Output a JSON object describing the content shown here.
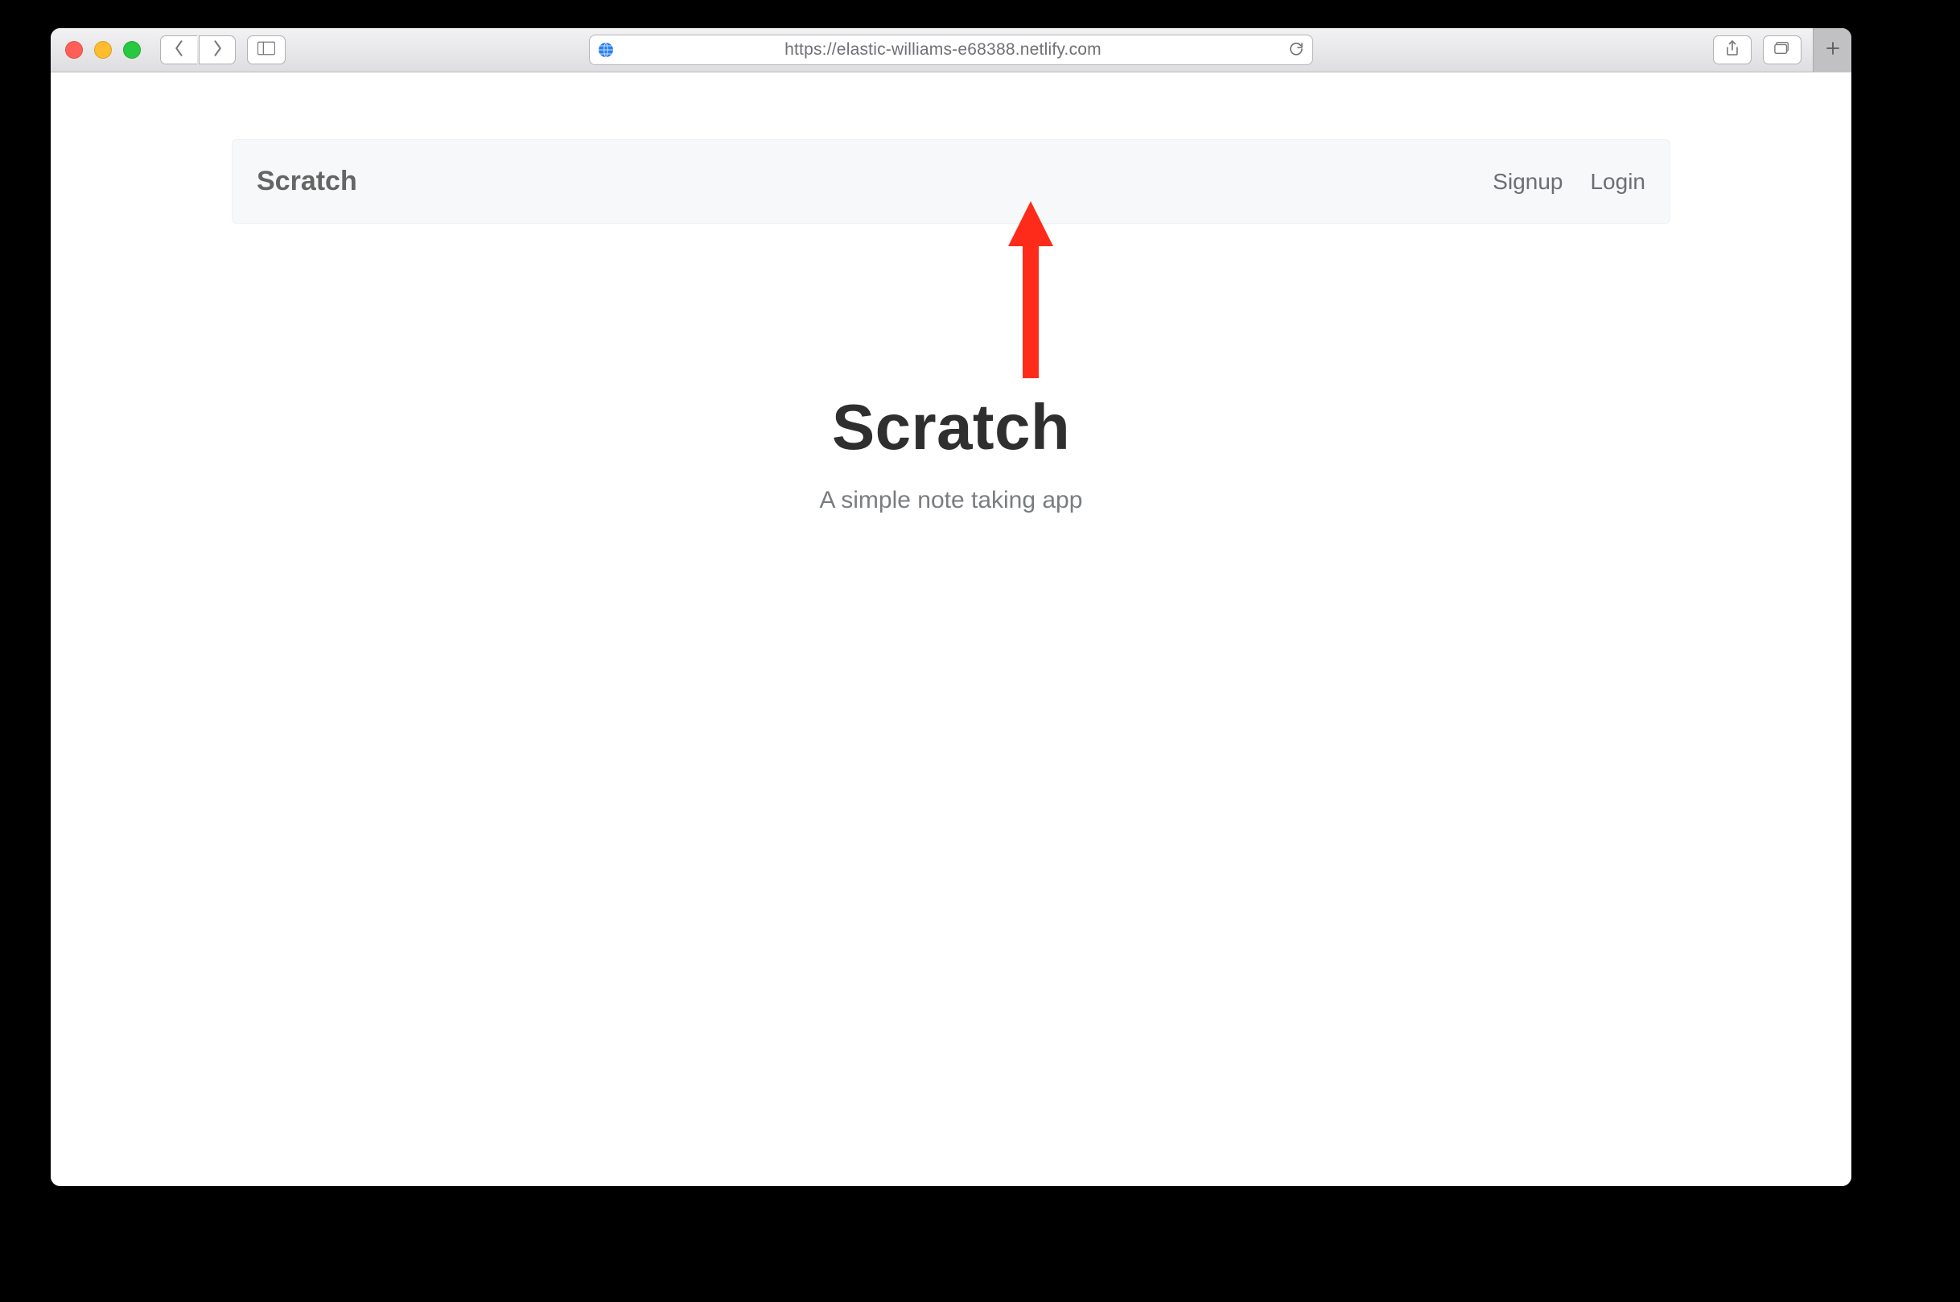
{
  "browser": {
    "url": "https://elastic-williams-e68388.netlify.com"
  },
  "app_nav": {
    "brand": "Scratch",
    "links": {
      "signup": "Signup",
      "login": "Login"
    }
  },
  "hero": {
    "title": "Scratch",
    "subtitle": "A simple note taking app"
  },
  "annotation": {
    "arrow_color": "#ff2b1a"
  }
}
